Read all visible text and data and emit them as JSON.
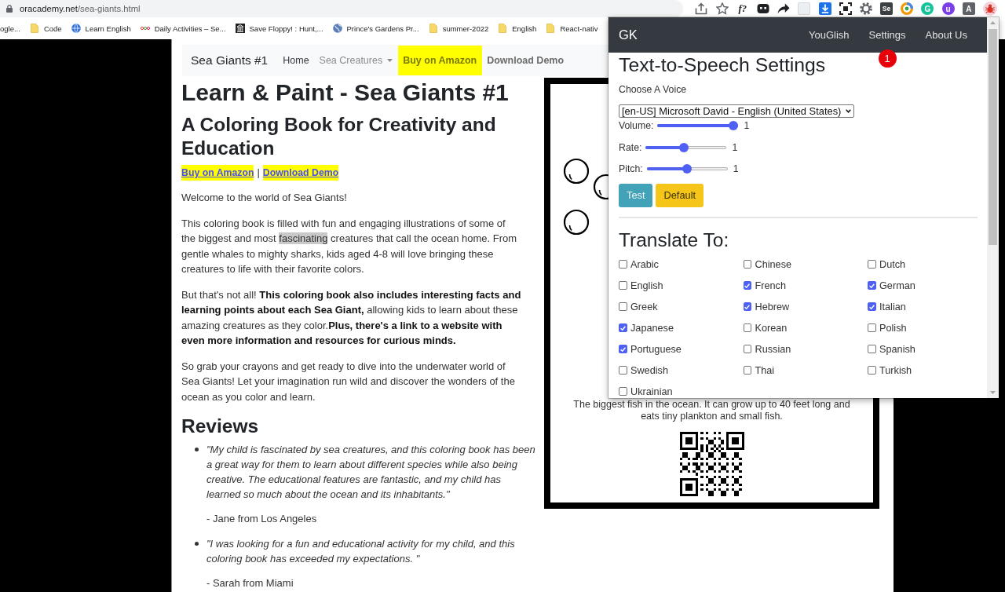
{
  "browser": {
    "address": {
      "host": "oracademy.net",
      "path": "/sea-giants.html"
    },
    "extension_glyphs": [
      "f?",
      "Se",
      "G",
      "u",
      "A"
    ],
    "bookmarks": [
      {
        "label": "ogle...",
        "kind": "text"
      },
      {
        "label": "Code",
        "kind": "folder"
      },
      {
        "label": "Learn English",
        "kind": "globe"
      },
      {
        "label": "Daily Activities – Se...",
        "kind": "dots"
      },
      {
        "label": "Save Floppy! : Hunt,...",
        "kind": "building"
      },
      {
        "label": "Prince's Gardens Pr...",
        "kind": "earth"
      },
      {
        "label": "summer-2022",
        "kind": "folder"
      },
      {
        "label": "English",
        "kind": "folder"
      },
      {
        "label": "React-nativ",
        "kind": "folder"
      }
    ]
  },
  "site_nav": {
    "brand": "Sea Giants #1",
    "items": [
      {
        "label": "Home",
        "kind": "link"
      },
      {
        "label": "Sea Creatures",
        "kind": "dropdown"
      },
      {
        "label": "Buy on Amazon",
        "kind": "highlight"
      },
      {
        "label": "Download Demo",
        "kind": "strong"
      }
    ]
  },
  "article": {
    "title": "Learn & Paint - Sea Giants #1",
    "subtitle": "A Coloring Book for Creativity and Education",
    "links": [
      {
        "label": "Buy on Amazon"
      },
      {
        "label": "Download Demo"
      }
    ],
    "separator": "|",
    "paragraphs": [
      {
        "parts": [
          {
            "text": "Welcome to the world of Sea Giants!",
            "highlighted": false
          }
        ]
      },
      {
        "parts": [
          {
            "text": "This coloring book is filled with fun and engaging illustrations of some of the biggest and most ",
            "highlighted": false
          },
          {
            "text": "fascinating",
            "highlighted": true
          },
          {
            "text": " creatures that call the ocean home. From gentle whales to mighty sharks, kids aged 4-8 will love bringing these creatures to life with their favorite colors.",
            "highlighted": false
          }
        ]
      },
      {
        "parts": [
          {
            "text": "But that's not all! **This coloring book also includes interesting facts and learning points about each Sea Giant,** allowing kids to learn about these amazing creatures as they color.**Plus, there's a link to a website with even more information and resources for curious minds.**",
            "highlighted": false
          }
        ]
      },
      {
        "parts": [
          {
            "text": "So grab your crayons and get ready to dive into the underwater world of Sea Giants! Let your imagination run wild and discover the wonders of the ocean as you color and learn.",
            "highlighted": false
          }
        ]
      }
    ],
    "reviews": {
      "heading": "Reviews",
      "items": [
        {
          "quote": "\"My child is fascinated by sea creatures, and this coloring book has been a great way for them to learn about different species while also being creative. The educational features are fantastic, and my child has learned so much about the ocean and its inhabitants.\"",
          "author": "- Jane from Los Angeles"
        },
        {
          "quote": "\"I was looking for a fun and educational activity for my child, and this coloring book has exceeded my expectations. \"",
          "author": "- Sarah from Miami"
        }
      ]
    }
  },
  "illustration": {
    "caption": "The biggest fish in the ocean. It can grow up to 40 feet long and eats tiny plankton and small fish."
  },
  "popup": {
    "brand": "GK",
    "nav": [
      {
        "label": "YouGlish"
      },
      {
        "label": "Settings"
      },
      {
        "label": "About Us"
      }
    ],
    "badge": "1",
    "title": "Text-to-Speech Settings",
    "voice_label": "Choose A Voice",
    "voice": "[en-US] Microsoft David - English (United States)",
    "sliders": [
      {
        "label": "Volume:",
        "level": 1,
        "reading": "1"
      },
      {
        "label": "Rate:",
        "level": 0.47,
        "reading": "1"
      },
      {
        "label": "Pitch:",
        "level": 0.5,
        "reading": "1"
      }
    ],
    "buttons": [
      {
        "label": "Test",
        "kind": "info"
      },
      {
        "label": "Default",
        "kind": "warning"
      }
    ],
    "translate_heading": "Translate To:",
    "languages": [
      {
        "label": "Arabic",
        "checked": false
      },
      {
        "label": "Chinese",
        "checked": false
      },
      {
        "label": "Dutch",
        "checked": false
      },
      {
        "label": "English",
        "checked": false
      },
      {
        "label": "French",
        "checked": true
      },
      {
        "label": "German",
        "checked": true
      },
      {
        "label": "Greek",
        "checked": false
      },
      {
        "label": "Hebrew",
        "checked": true
      },
      {
        "label": "Italian",
        "checked": true
      },
      {
        "label": "Japanese",
        "checked": true
      },
      {
        "label": "Korean",
        "checked": false
      },
      {
        "label": "Polish",
        "checked": false
      },
      {
        "label": "Portuguese",
        "checked": true
      },
      {
        "label": "Russian",
        "checked": false
      },
      {
        "label": "Spanish",
        "checked": false
      },
      {
        "label": "Swedish",
        "checked": false
      },
      {
        "label": "Thai",
        "checked": false
      },
      {
        "label": "Turkish",
        "checked": false
      },
      {
        "label": "Ukrainian",
        "checked": false
      }
    ]
  }
}
